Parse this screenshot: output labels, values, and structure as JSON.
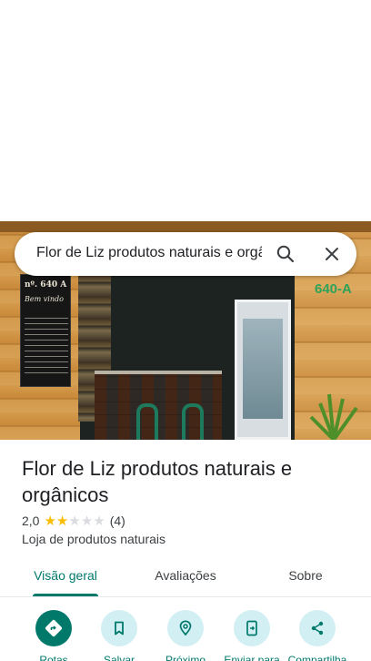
{
  "search": {
    "query": "Flor de Liz produtos naturais e orgânicos"
  },
  "place": {
    "name": "Flor de Liz produtos naturais e orgânicos",
    "rating": "2,0",
    "rating_fraction": 0.4,
    "review_count": "(4)",
    "category": "Loja de produtos naturais",
    "photo_sign": {
      "number": "nº. 640 A",
      "welcome": "Bem vindo"
    },
    "address_painted": "640-A"
  },
  "tabs": [
    {
      "label": "Visão geral",
      "active": true
    },
    {
      "label": "Avaliações",
      "active": false
    },
    {
      "label": "Sobre",
      "active": false
    }
  ],
  "actions": [
    {
      "label": "Rotas",
      "icon": "directions-icon"
    },
    {
      "label": "Salvar",
      "icon": "bookmark-icon"
    },
    {
      "label": "Próximo",
      "icon": "nearby-icon"
    },
    {
      "label": "Enviar para",
      "icon": "send-to-phone-icon"
    },
    {
      "label": "Compartilha",
      "icon": "share-icon"
    }
  ],
  "colors": {
    "accent": "#00796b",
    "star": "#fbbc04",
    "action_bg": "#d2f0f4"
  }
}
